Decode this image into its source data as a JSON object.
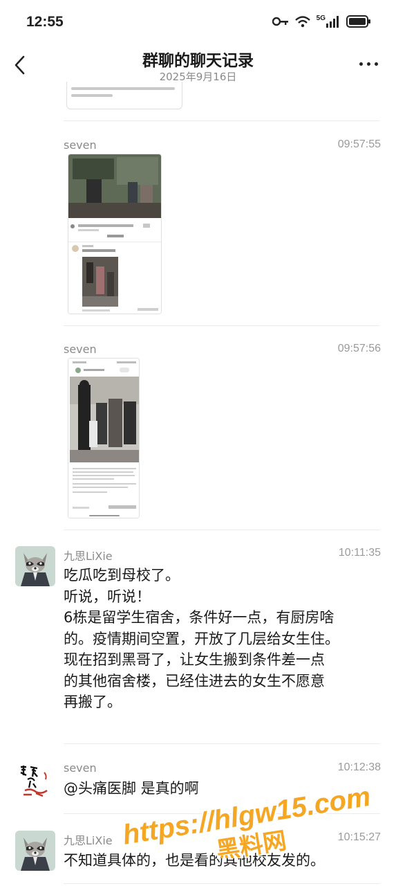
{
  "status_bar": {
    "time": "12:55",
    "network": "5G",
    "icons": [
      "key-icon",
      "wifi-icon",
      "signal-icon",
      "battery-icon"
    ]
  },
  "header": {
    "title": "群聊的聊天记录",
    "subtitle": "2025年9月16日",
    "icons": [
      "back-icon",
      "more-icon"
    ]
  },
  "messages": [
    {
      "sender": "seven",
      "time": "09:57:55",
      "type": "image"
    },
    {
      "sender": "seven",
      "time": "09:57:56",
      "type": "image"
    },
    {
      "sender": "九思LiXie",
      "time": "10:11:35",
      "type": "text",
      "lines": [
        "吃瓜吃到母校了。",
        "听说，听说！",
        "6栋是留学生宿舍，条件好一点，有厨房啥",
        "的。疫情期间空置，开放了几层给女生住。",
        "现在招到黑哥了，让女生搬到条件差一点",
        "的其他宿舍楼，已经住进去的女生不愿意",
        "再搬了。"
      ]
    },
    {
      "sender": "seven",
      "time": "10:12:38",
      "type": "text",
      "text": "@头痛医脚 是真的啊"
    },
    {
      "sender": "九思LiXie",
      "time": "10:15:27",
      "type": "text",
      "text": "不知道具体的，也是看的其他校友发的。"
    }
  ],
  "watermark": {
    "url": "https://hlgw15.com",
    "brand": "黑料网",
    "color": "#f5a623"
  },
  "colors": {
    "sender": "#8a8a8a",
    "timestamp": "#9a9a9a",
    "divider": "#ececec"
  }
}
